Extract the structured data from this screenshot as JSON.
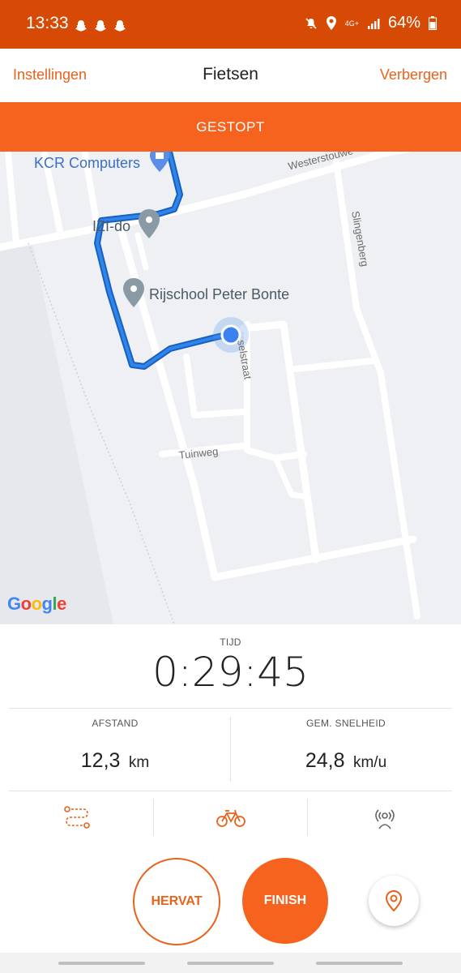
{
  "status_bar": {
    "time": "13:33",
    "network": "4G+",
    "battery": "64%",
    "icons": [
      "snapchat-icon",
      "snapchat-icon",
      "snapchat-icon",
      "mute-icon",
      "location-icon",
      "signal-icon",
      "battery-icon"
    ]
  },
  "nav": {
    "left_link": "Instellingen",
    "title": "Fietsen",
    "right_link": "Verbergen"
  },
  "banner": {
    "text": "GESTOPT"
  },
  "map": {
    "labels": {
      "poi_kcr": "KCR Computers",
      "poi_izi": "IZI-do",
      "poi_rijschool": "Rijschool Peter Bonte",
      "street_westerstouwe": "Westerstouwe",
      "street_slingenberg": "Slingenberg",
      "street_partial": "selstraat",
      "street_tuinweg": "Tuinweg"
    },
    "attribution": {
      "letters": [
        "G",
        "o",
        "o",
        "g",
        "l",
        "e"
      ],
      "colors": [
        "#4285f4",
        "#ea4335",
        "#fbbc05",
        "#4285f4",
        "#34a853",
        "#ea4335"
      ]
    },
    "route_color": "#1a6fd6"
  },
  "stats": {
    "time_label": "TIJD",
    "time_value": "0:29:45",
    "distance_label": "AFSTAND",
    "distance_value": "12,3",
    "distance_unit": "km",
    "speed_label": "GEM. SNELHEID",
    "speed_value": "24,8",
    "speed_unit": "km/u"
  },
  "tabs": [
    "route-icon",
    "bike-icon",
    "beacon-icon"
  ],
  "buttons": {
    "resume": "HERVAT",
    "finish": "FINISH"
  },
  "colors": {
    "accent": "#f5631f",
    "status_bar": "#d64a05",
    "link": "#e8621c"
  }
}
